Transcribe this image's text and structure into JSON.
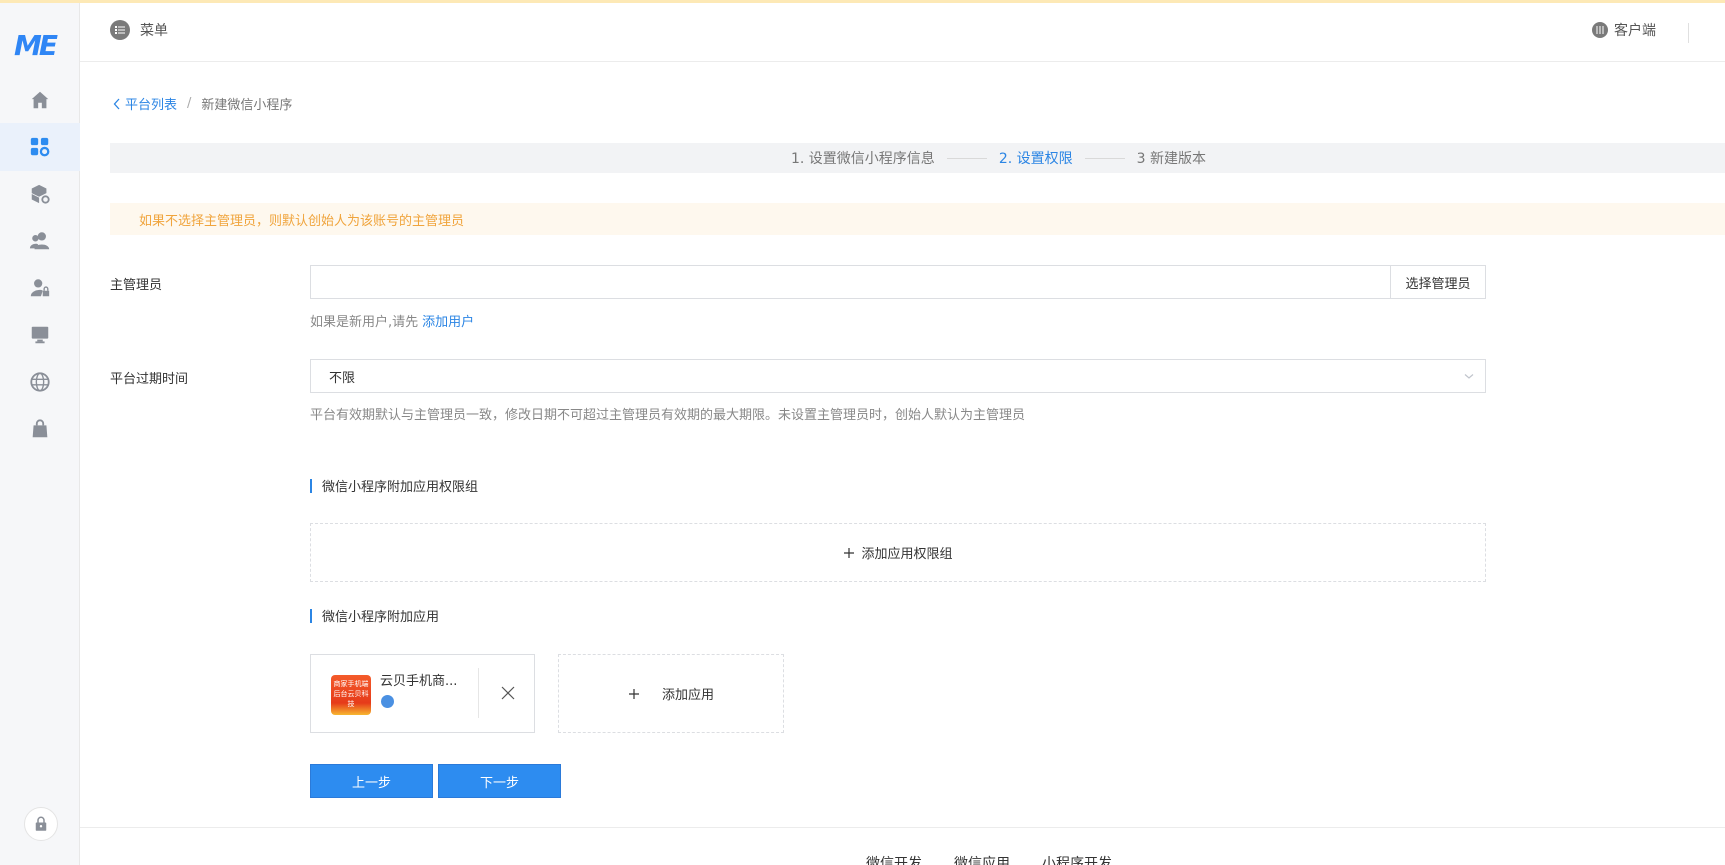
{
  "header": {
    "menu_label": "菜单",
    "client_label": "客户端"
  },
  "sidebar": {
    "logo_text": "ME",
    "items": [
      {
        "icon": "home-icon"
      },
      {
        "icon": "apps-gear-icon",
        "active": true
      },
      {
        "icon": "cube-gear-icon"
      },
      {
        "icon": "users-icon"
      },
      {
        "icon": "user-lock-icon"
      },
      {
        "icon": "monitor-icon"
      },
      {
        "icon": "globe-icon"
      },
      {
        "icon": "bag-icon"
      }
    ]
  },
  "breadcrumb": {
    "back_label": "平台列表",
    "separator": "/",
    "current": "新建微信小程序"
  },
  "steps": [
    {
      "label": "1. 设置微信小程序信息",
      "active": false
    },
    {
      "label": "2. 设置权限",
      "active": true
    },
    {
      "label": "3 新建版本",
      "active": false
    }
  ],
  "notice": "如果不选择主管理员，则默认创始人为该账号的主管理员",
  "form": {
    "admin_label": "主管理员",
    "admin_value": "",
    "select_admin_button": "选择管理员",
    "new_user_hint": "如果是新用户,请先",
    "add_user_link": "添加用户",
    "expire_label": "平台过期时间",
    "expire_value": "不限",
    "expire_hint": "平台有效期默认与主管理员一致，修改日期不可超过主管理员有效期的最大期限。未设置主管理员时，创始人默认为主管理员"
  },
  "permission_group": {
    "title": "微信小程序附加应用权限组",
    "add_label": "添加应用权限组"
  },
  "apps": {
    "title": "微信小程序附加应用",
    "items": [
      {
        "name": "云贝手机商...",
        "thumb_text": "商家手机端后台云贝科技"
      }
    ],
    "add_label": "添加应用"
  },
  "buttons": {
    "prev": "上一步",
    "next": "下一步"
  },
  "footer": {
    "links": [
      "微信开发",
      "微信应用",
      "小程序开发"
    ]
  },
  "colors": {
    "primary": "#2d8cf0",
    "link": "#2b85e4",
    "notice_text": "#f0a43c",
    "notice_bg": "#fef8ee"
  }
}
